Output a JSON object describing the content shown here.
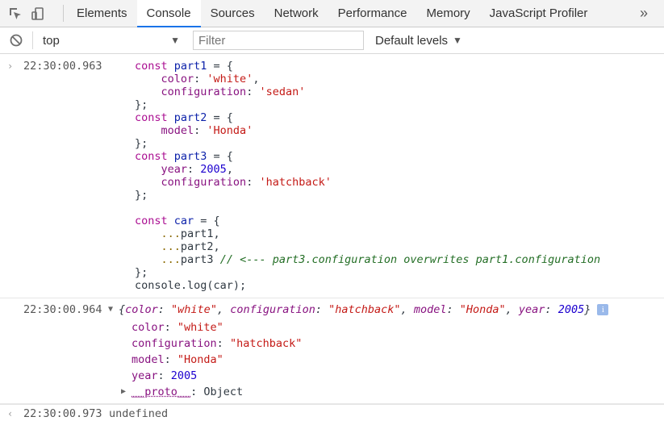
{
  "tabs": [
    "Elements",
    "Console",
    "Sources",
    "Network",
    "Performance",
    "Memory",
    "JavaScript Profiler"
  ],
  "active_tab": "Console",
  "more_label": "»",
  "toolbar": {
    "context": "top",
    "filter_placeholder": "Filter",
    "levels": "Default levels"
  },
  "input_entry": {
    "timestamp": "22:30:00.963"
  },
  "output_entry": {
    "timestamp": "22:30:00.964",
    "properties": [
      {
        "key": "color",
        "value": "\"white\"",
        "type": "string"
      },
      {
        "key": "configuration",
        "value": "\"hatchback\"",
        "type": "string"
      },
      {
        "key": "model",
        "value": "\"Honda\"",
        "type": "string"
      },
      {
        "key": "year",
        "value": "2005",
        "type": "number"
      }
    ],
    "proto_key": "__proto__",
    "proto_value": "Object"
  },
  "result_entry": {
    "timestamp": "22:30:00.973",
    "value": "undefined"
  },
  "colors": {
    "accent": "#1a73e8",
    "keyword": "#aa0d91",
    "string": "#c41a16",
    "number": "#1c00cf",
    "comment": "#236e25"
  },
  "icons": [
    "inspect-element-icon",
    "device-toolbar-icon",
    "clear-console-icon",
    "expand-caret-icon",
    "info-icon"
  ]
}
